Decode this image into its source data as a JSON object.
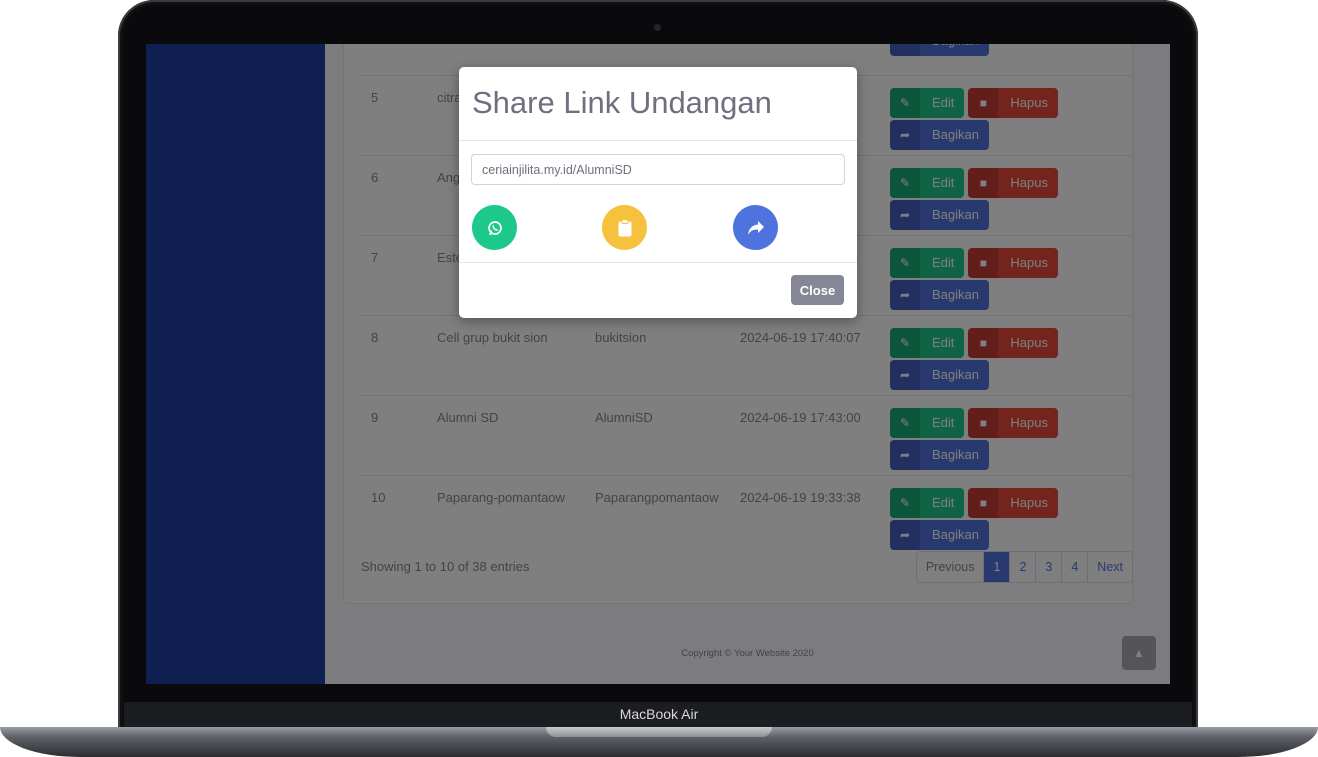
{
  "device": {
    "model_label": "MacBook Air"
  },
  "table": {
    "rows": [
      {
        "no": "",
        "nama": "",
        "link": "",
        "tanggal": "",
        "partial": true
      },
      {
        "no": "5",
        "nama": "citra s",
        "link": "",
        "tanggal": ""
      },
      {
        "no": "6",
        "nama": "Angel",
        "link": "",
        "tanggal": ""
      },
      {
        "no": "7",
        "nama": "Ester",
        "link": "",
        "tanggal": ""
      },
      {
        "no": "8",
        "nama": "Cell grup bukit sion",
        "link": "bukitsion",
        "tanggal": "2024-06-19 17:40:07"
      },
      {
        "no": "9",
        "nama": "Alumni SD",
        "link": "AlumniSD",
        "tanggal": "2024-06-19 17:43:00"
      },
      {
        "no": "10",
        "nama": "Paparang-pomantaow",
        "link": "Paparangpomantaow",
        "tanggal": "2024-06-19 19:33:38"
      }
    ],
    "actions": {
      "edit": "Edit",
      "hapus": "Hapus",
      "bagikan": "Bagikan"
    },
    "showing": "Showing 1 to 10 of 38 entries",
    "pagination": [
      "Previous",
      "1",
      "2",
      "3",
      "4",
      "Next"
    ],
    "active_page": "1"
  },
  "footer": {
    "copyright": "Copyright © Your Website 2020"
  },
  "modal": {
    "title": "Share Link Undangan",
    "link_value": "ceriainjilita.my.id/AlumniSD",
    "close_label": "Close",
    "share_buttons": [
      {
        "name": "whatsapp-share-button",
        "icon": "whatsapp-icon",
        "color": "#1cc88a"
      },
      {
        "name": "copy-link-button",
        "icon": "clipboard-icon",
        "color": "#f6c23e"
      },
      {
        "name": "share-button",
        "icon": "share-arrow-icon",
        "color": "#4e73df"
      }
    ]
  },
  "colors": {
    "sidebar": "#1f3ea4",
    "success": "#1cc88a",
    "danger": "#e74a3b",
    "primary": "#4e73df",
    "secondary": "#858796"
  }
}
